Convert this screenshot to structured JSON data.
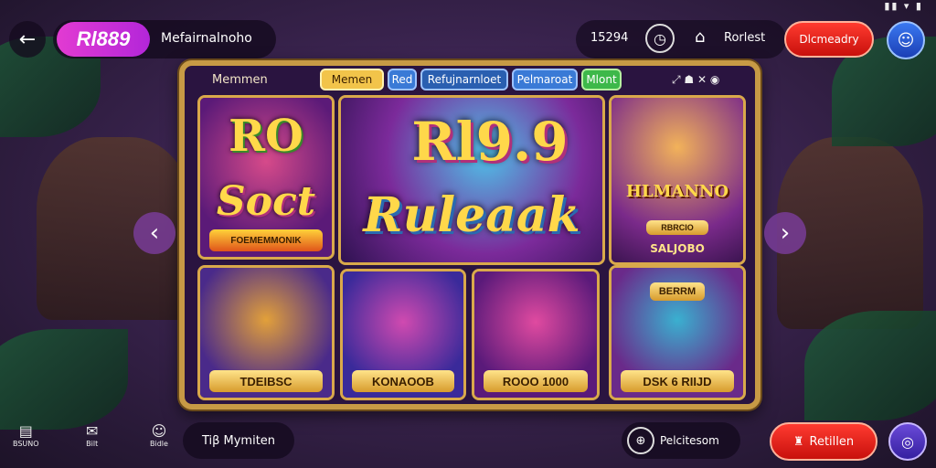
{
  "status_bar": {
    "icons": "▮▮ ▾ ▮"
  },
  "header": {
    "back_icon": "←",
    "logo": "Rl889",
    "subtitle": "Mefairnalnoho",
    "coins": "15294",
    "timer_icon": "◷",
    "home_icon": "⌂",
    "reset_label": "Rorlest",
    "primary_button": "Dlcmeadry",
    "profile_icon": "☺"
  },
  "panel": {
    "menu_label": "Memmen",
    "tabs": [
      {
        "label": "Memen",
        "active": true,
        "color": "#f2c44a"
      },
      {
        "label": "Red",
        "active": false,
        "color": "#3a7ad6"
      },
      {
        "label": "Refujnarnloet",
        "active": false,
        "color": "#2a5fb0"
      },
      {
        "label": "Pelmaroat",
        "active": false,
        "color": "#3a7ad6"
      },
      {
        "label": "Mlont",
        "active": false,
        "color": "#3db84a"
      }
    ],
    "tray_icons": "⤢ ☗ ✕ ◉"
  },
  "games": [
    {
      "title_1": "RO",
      "title_2": "Soct",
      "caption": "FOEMEMMONIK"
    },
    {
      "title_1": "Rl9.9",
      "title_2": "Ruleaak"
    },
    {
      "title": "HLMANNO",
      "badge": "RBRCIO",
      "caption": "SALJOBO"
    },
    {
      "caption": "TDEIBSC"
    },
    {
      "caption": "KONAOOB"
    },
    {
      "caption": "ROOO 1000"
    },
    {
      "title": "BERRM",
      "caption": "DSK 6 RIIJD"
    }
  ],
  "nav": {
    "prev_icon": "‹",
    "next_icon": "›"
  },
  "bottom": {
    "items": [
      {
        "icon": "▤",
        "label": "BSUNO"
      },
      {
        "icon": "✉",
        "label": "Bilt"
      },
      {
        "icon": "☺",
        "label": "Bidle"
      }
    ],
    "pill_label": "Tiβ Mymiten",
    "progress_label": "Pelcitesom",
    "progress_icon": "⊕",
    "red_label": "Retillen",
    "red_icon": "♜",
    "circle_icon": "◎"
  }
}
